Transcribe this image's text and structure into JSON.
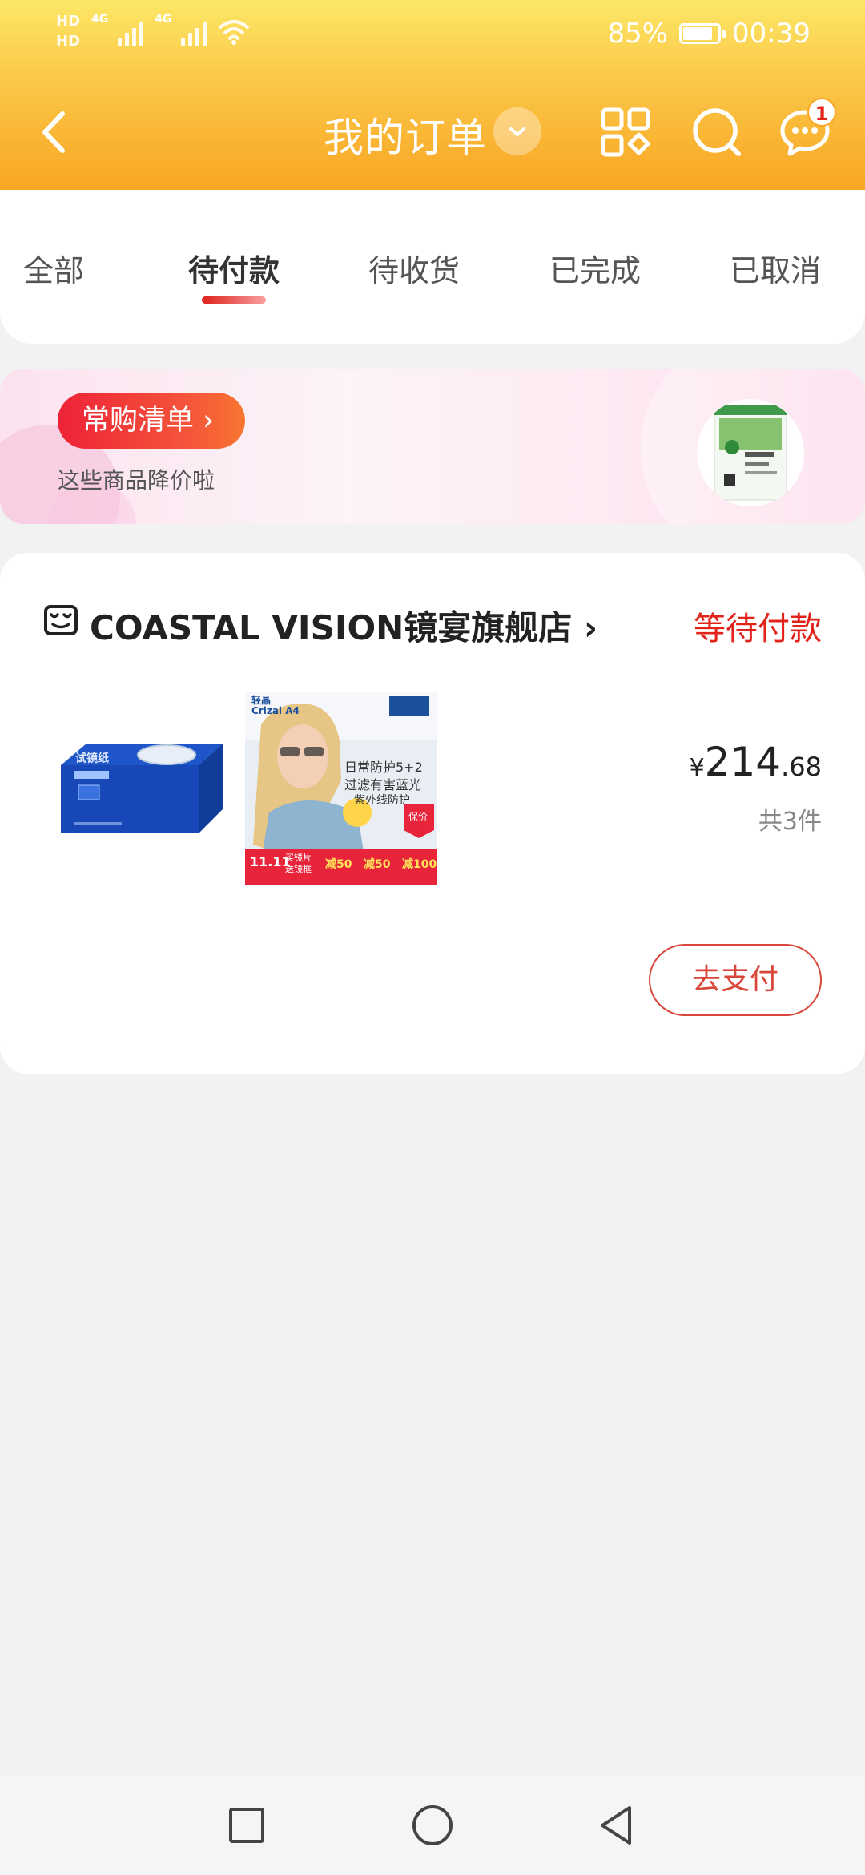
{
  "status_bar": {
    "hd1": "HD",
    "hd2": "HD",
    "net1": "4G",
    "net2": "4G",
    "battery_percent_text": "85%",
    "battery_level": 0.85,
    "time": "00:39"
  },
  "nav": {
    "title": "我的订单",
    "message_badge": "1",
    "icons": [
      "back-icon",
      "chevron-down-icon",
      "grid-icon",
      "search-icon",
      "message-icon"
    ]
  },
  "tabs": [
    {
      "label": "全部",
      "active": false
    },
    {
      "label": "待付款",
      "active": true
    },
    {
      "label": "待收货",
      "active": false
    },
    {
      "label": "已完成",
      "active": false
    },
    {
      "label": "已取消",
      "active": false
    }
  ],
  "banner": {
    "button_label": "常购清单 ›",
    "subtitle": "这些商品降价啦"
  },
  "order": {
    "shop_name": "COASTAL VISION镜宴旗舰店 ›",
    "status": "等待付款",
    "price_currency": "¥",
    "price_integer": "214",
    "price_decimal": ".68",
    "quantity": "共3件",
    "pay_button": "去支付",
    "product2_overlay": {
      "brand": "轻晶 Crizal A4",
      "line1": "日常防护5+2",
      "line2": "过滤有害蓝光",
      "line3": "紫外线防护",
      "tag": "保价",
      "promo_date": "11.11",
      "promo_1": "买镜片",
      "promo_2": "送镜框",
      "promo_3": "减50",
      "promo_4": "减50",
      "promo_5": "减100"
    },
    "product1_label": "试镜纸"
  },
  "colors": {
    "accent_red": "#e2231a",
    "header_top": "#fde766",
    "header_bottom": "#f8a623"
  }
}
